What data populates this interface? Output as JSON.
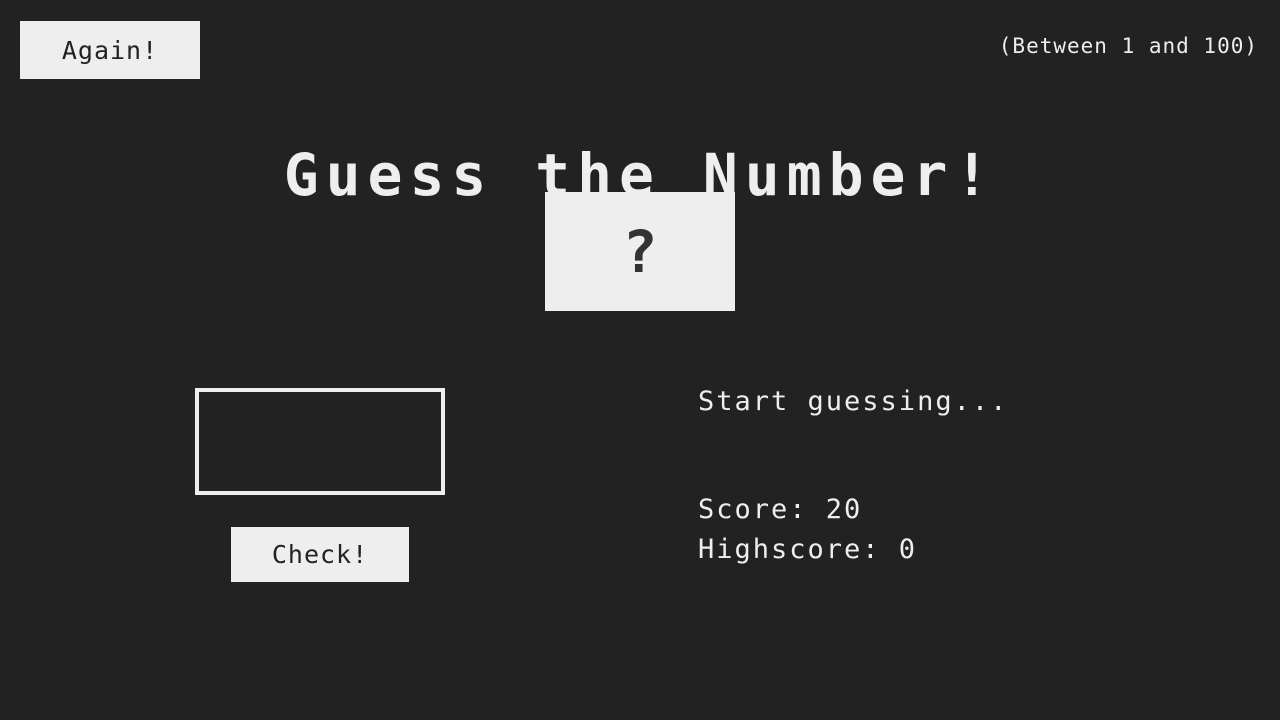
{
  "app": {
    "title": "Guess the Number!",
    "background_color": "#222222",
    "foreground_color": "#eeeeee",
    "accent_dark": "#333333"
  },
  "header": {
    "again_button_label": "Again!",
    "range_hint": "(Between 1 and 100)"
  },
  "display": {
    "secret_number": "?"
  },
  "form": {
    "guess_value": "",
    "guess_placeholder": "",
    "check_button_label": "Check!"
  },
  "status": {
    "message": "Start guessing...",
    "score_label": "Score: 20",
    "highscore_label": "Highscore: 0",
    "score_value": 20,
    "highscore_value": 0
  }
}
